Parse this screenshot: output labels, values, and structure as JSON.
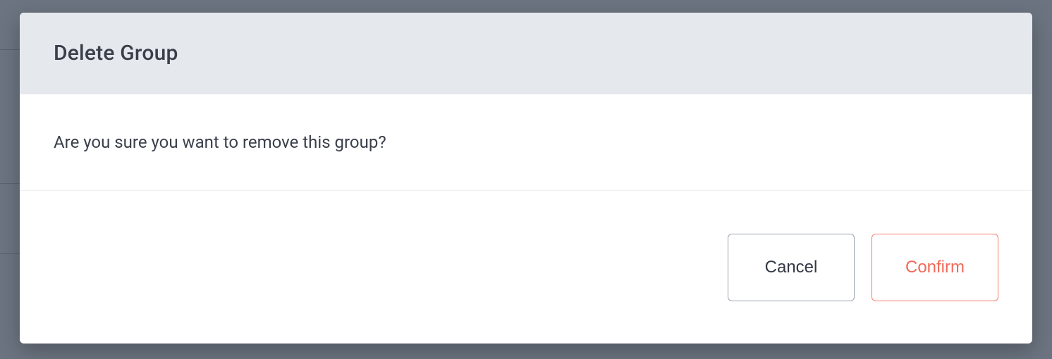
{
  "dialog": {
    "title": "Delete Group",
    "message": "Are you sure you want to remove this group?",
    "cancel_label": "Cancel",
    "confirm_label": "Confirm"
  },
  "colors": {
    "page_bg": "#6b7480",
    "header_bg": "#e5e9ee",
    "text": "#3a3f4a",
    "cancel_border": "#9aa2af",
    "confirm_border": "#f47a6a",
    "confirm_text": "#f16a58"
  }
}
